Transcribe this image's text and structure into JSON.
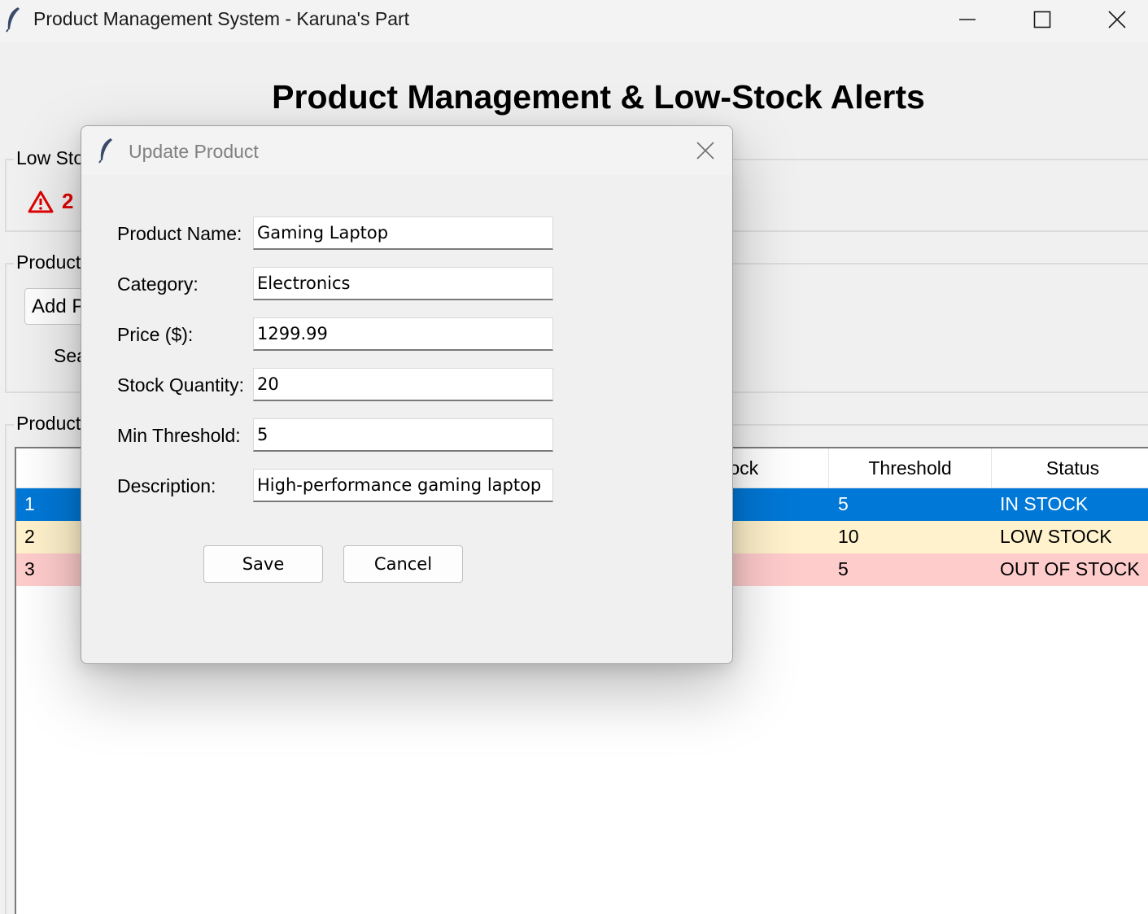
{
  "window": {
    "title": "Product Management System - Karuna's Part"
  },
  "main": {
    "heading": "Product Management & Low-Stock Alerts",
    "low_stock_group_label": "Low Sto",
    "alert_count": "2",
    "product_group_label": "Product",
    "add_button_label": "Add P",
    "search_label": "Sea",
    "list_group_label": "Product"
  },
  "table": {
    "headers": {
      "stock": "tock",
      "threshold": "Threshold",
      "status": "Status"
    },
    "rows": [
      {
        "id": "1",
        "threshold": "5",
        "status": "IN STOCK"
      },
      {
        "id": "2",
        "threshold": "10",
        "status": "LOW STOCK"
      },
      {
        "id": "3",
        "threshold": "5",
        "status": "OUT OF STOCK"
      }
    ]
  },
  "dialog": {
    "title": "Update Product",
    "fields": {
      "name": {
        "label": "Product Name:",
        "value": "Gaming Laptop"
      },
      "category": {
        "label": "Category:",
        "value": "Electronics"
      },
      "price": {
        "label": "Price ($):",
        "value": "1299.99"
      },
      "stock": {
        "label": "Stock Quantity:",
        "value": "20"
      },
      "threshold": {
        "label": "Min Threshold:",
        "value": "5"
      },
      "description": {
        "label": "Description:",
        "value": "High-performance gaming laptop"
      }
    },
    "save_label": "Save",
    "cancel_label": "Cancel"
  },
  "colors": {
    "selected_row": "#0078d7",
    "low_stock_row": "#fff2cc",
    "out_of_stock_row": "#ffcccc",
    "alert_red": "#e00000"
  },
  "icons": {
    "app": "feather-icon",
    "alert": "warning-icon"
  }
}
